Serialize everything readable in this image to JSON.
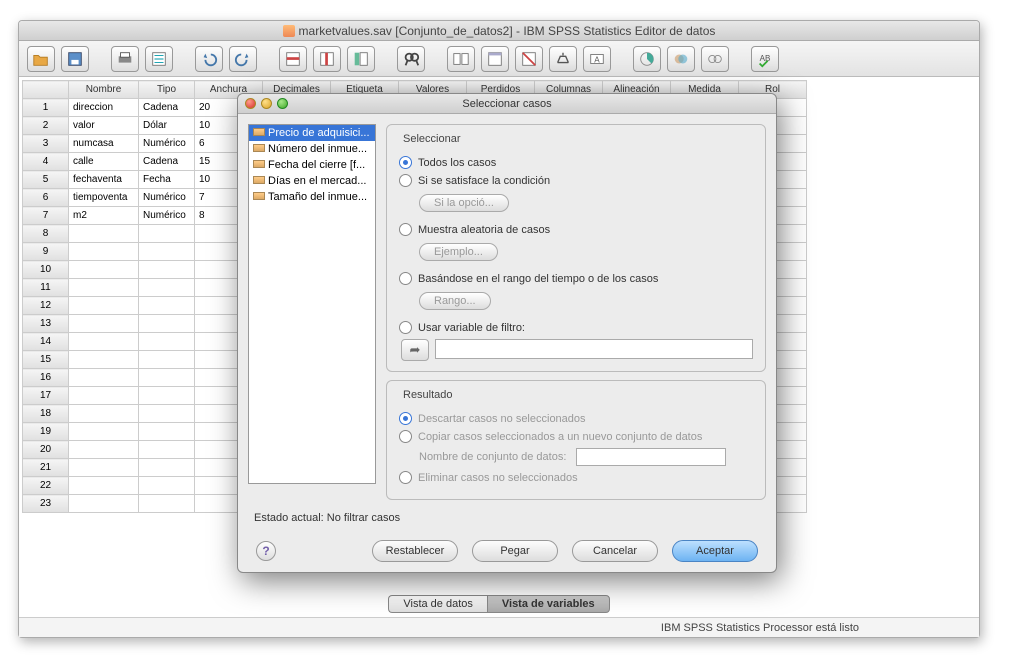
{
  "window": {
    "title": "marketvalues.sav [Conjunto_de_datos2] - IBM SPSS Statistics Editor de datos"
  },
  "columns": {
    "nombre": "Nombre",
    "tipo": "Tipo",
    "anchura": "Anchura",
    "decimales": "Decimales",
    "etiqueta": "Etiqueta",
    "valores": "Valores",
    "perdidos": "Perdidos",
    "columnas": "Columnas",
    "alineacion": "Alineación",
    "medida": "Medida",
    "rol": "Rol"
  },
  "rows": [
    {
      "n": "1",
      "nombre": "direccion",
      "tipo": "Cadena",
      "anchura": "20"
    },
    {
      "n": "2",
      "nombre": "valor",
      "tipo": "Dólar",
      "anchura": "10"
    },
    {
      "n": "3",
      "nombre": "numcasa",
      "tipo": "Numérico",
      "anchura": "6"
    },
    {
      "n": "4",
      "nombre": "calle",
      "tipo": "Cadena",
      "anchura": "15"
    },
    {
      "n": "5",
      "nombre": "fechaventa",
      "tipo": "Fecha",
      "anchura": "10"
    },
    {
      "n": "6",
      "nombre": "tiempoventa",
      "tipo": "Numérico",
      "anchura": "7"
    },
    {
      "n": "7",
      "nombre": "m2",
      "tipo": "Numérico",
      "anchura": "8"
    }
  ],
  "tabs": {
    "data": "Vista de datos",
    "vars": "Vista de variables"
  },
  "status": "IBM SPSS Statistics Processor está listo",
  "dialog": {
    "title": "Seleccionar casos",
    "vars": [
      "Precio de adquisici...",
      "Número del inmue...",
      "Fecha del cierre [f...",
      "Días en el mercad...",
      "Tamaño del inmue..."
    ],
    "select": {
      "legend": "Seleccionar",
      "all": "Todos los casos",
      "cond": "Si se satisface la condición",
      "cond_btn": "Si la opció...",
      "random": "Muestra aleatoria de casos",
      "random_btn": "Ejemplo...",
      "range": "Basándose en el rango del tiempo o de los casos",
      "range_btn": "Rango...",
      "filter": "Usar variable de filtro:"
    },
    "result": {
      "legend": "Resultado",
      "discard": "Descartar casos no seleccionados",
      "copy": "Copiar casos seleccionados a un nuevo conjunto de datos",
      "dataset_label": "Nombre de conjunto de datos:",
      "delete": "Eliminar casos no seleccionados"
    },
    "current_status": "Estado actual: No filtrar casos",
    "buttons": {
      "reset": "Restablecer",
      "paste": "Pegar",
      "cancel": "Cancelar",
      "ok": "Aceptar"
    }
  }
}
